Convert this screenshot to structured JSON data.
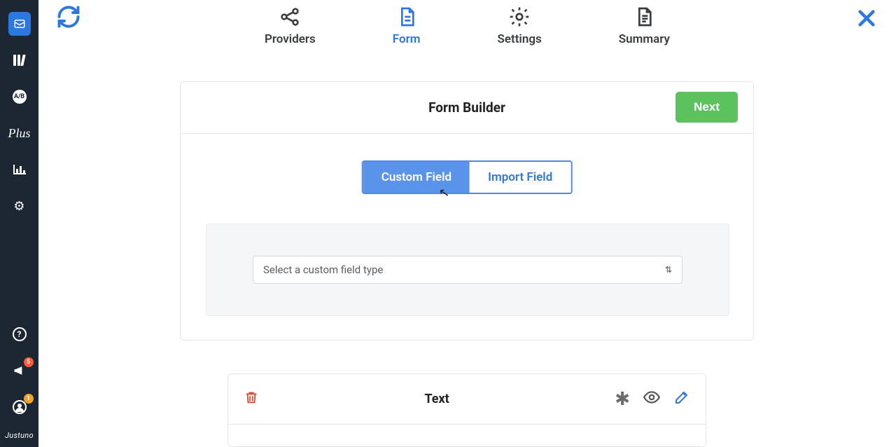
{
  "sidebar": {
    "ab_label": "A/B",
    "plus_label": "Plus",
    "brand": "Justuno",
    "badges": {
      "announce": "5",
      "account": "1"
    }
  },
  "steps": {
    "providers": "Providers",
    "form": "Form",
    "settings": "Settings",
    "summary": "Summary"
  },
  "card": {
    "title": "Form Builder",
    "next": "Next",
    "tabs": {
      "custom": "Custom Field",
      "import": "Import Field"
    },
    "select_placeholder": "Select a custom field type"
  },
  "field": {
    "title": "Text"
  }
}
